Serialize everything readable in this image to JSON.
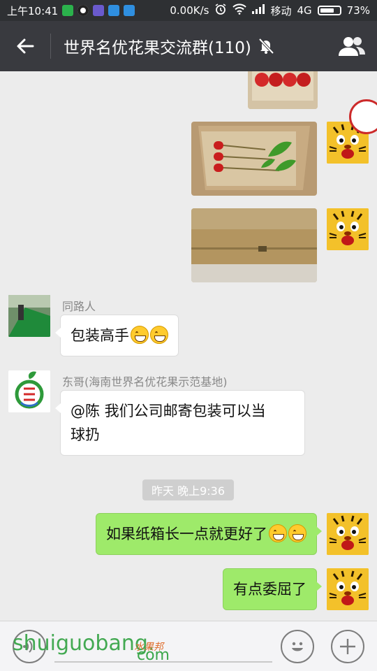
{
  "status_bar": {
    "time": "上午10:41",
    "net_speed": "0.00K/s",
    "carrier": "移动",
    "network": "4G",
    "battery": "73%",
    "battery_level": 0.73,
    "notification_colors": [
      "#2bb24c",
      "#222222",
      "#6a5acd",
      "#2f8fe0",
      "#2f8fe0"
    ]
  },
  "header": {
    "title": "世界名优花果交流群(110)",
    "back_icon": "arrow-left-icon",
    "mute_icon": "bell-off-icon",
    "members_icon": "group-icon"
  },
  "messages": [
    {
      "type": "image",
      "side": "right",
      "description_icon": "photo"
    },
    {
      "type": "image",
      "side": "right",
      "description_icon": "photo"
    },
    {
      "type": "image",
      "side": "right",
      "description_icon": "photo"
    },
    {
      "type": "text",
      "side": "left",
      "sender": "同路人",
      "text": "包装高手",
      "emoji_count": 2
    },
    {
      "type": "text",
      "side": "left",
      "sender": "东哥(海南世界名优花果示范基地)",
      "line1": "@陈 我们公司邮寄包装可以当",
      "line2": "球扔"
    },
    {
      "type": "timestamp",
      "text": "昨天 晚上9:36"
    },
    {
      "type": "text",
      "side": "right",
      "text": "如果纸箱长一点就更好了",
      "emoji_count": 2
    },
    {
      "type": "text",
      "side": "right",
      "text": "有点委屈了"
    }
  ],
  "input_bar": {
    "voice_icon": "voice-icon",
    "emoji_icon": "smiley-icon",
    "plus_icon": "plus-icon"
  },
  "watermark": {
    "main": "shuiguobang.",
    "small": "水果邦",
    "com": "com"
  },
  "colors": {
    "header_bg": "#393a3f",
    "chat_bg": "#ececec",
    "bubble_green": "#9eea6a",
    "bubble_white": "#ffffff"
  }
}
